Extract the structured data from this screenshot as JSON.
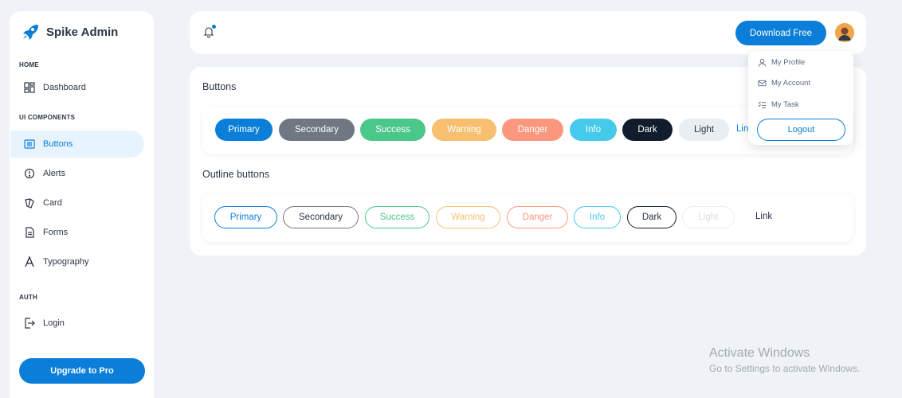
{
  "brand": {
    "name": "Spike Admin"
  },
  "sidebar": {
    "sections": [
      "HOME",
      "UI COMPONENTS",
      "AUTH"
    ],
    "items": [
      {
        "label": "Dashboard",
        "icon": "dashboard-icon"
      },
      {
        "label": "Buttons",
        "icon": "buttons-icon",
        "active": true
      },
      {
        "label": "Alerts",
        "icon": "alert-icon"
      },
      {
        "label": "Card",
        "icon": "card-icon"
      },
      {
        "label": "Forms",
        "icon": "forms-icon"
      },
      {
        "label": "Typography",
        "icon": "typography-icon"
      },
      {
        "label": "Login",
        "icon": "login-icon"
      }
    ],
    "upgrade_label": "Upgrade to Pro"
  },
  "header": {
    "download_label": "Download Free",
    "notification_icon": "bell-icon"
  },
  "dropdown": {
    "items": [
      {
        "label": "My Profile",
        "icon": "user-icon"
      },
      {
        "label": "My Account",
        "icon": "mail-icon"
      },
      {
        "label": "My Task",
        "icon": "list-check-icon"
      }
    ],
    "logout_label": "Logout"
  },
  "main": {
    "buttons_title": "Buttons",
    "outline_title": "Outline buttons",
    "solid_buttons": [
      {
        "label": "Primary",
        "color": "#0a7ed8"
      },
      {
        "label": "Secondary",
        "color": "#6e7782"
      },
      {
        "label": "Success",
        "color": "#4cc78a"
      },
      {
        "label": "Warning",
        "color": "#f7bf6f"
      },
      {
        "label": "Danger",
        "color": "#fb977d"
      },
      {
        "label": "Info",
        "color": "#46caeb"
      },
      {
        "label": "Dark",
        "color": "#111c2d"
      },
      {
        "label": "Light",
        "color": "#e9eef3"
      }
    ],
    "solid_link_label": "Lin",
    "outline_buttons": [
      {
        "label": "Primary",
        "color": "#0a7ed8"
      },
      {
        "label": "Secondary",
        "color": "#6e7782"
      },
      {
        "label": "Success",
        "color": "#4cc78a"
      },
      {
        "label": "Warning",
        "color": "#f7bf6f"
      },
      {
        "label": "Danger",
        "color": "#fb977d"
      },
      {
        "label": "Info",
        "color": "#46caeb"
      },
      {
        "label": "Dark",
        "color": "#111c2d"
      },
      {
        "label": "Light",
        "color": "#e9eef3"
      }
    ],
    "outline_link_label": "Link"
  },
  "watermark": {
    "title": "Activate Windows",
    "subtitle": "Go to Settings to activate Windows."
  }
}
